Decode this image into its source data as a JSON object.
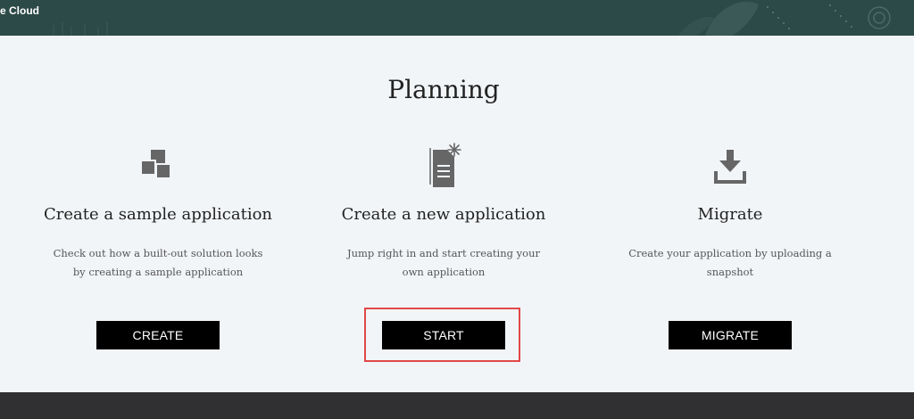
{
  "header": {
    "title": "e Cloud"
  },
  "main": {
    "title": "Planning",
    "cards": [
      {
        "icon": "sample-blocks-icon",
        "title": "Create a sample application",
        "description": "Check out how a built-out solution looks by creating a sample application",
        "button_label": "CREATE"
      },
      {
        "icon": "new-document-icon",
        "title": "Create a new application",
        "description": "Jump right in and start creating your own application",
        "button_label": "START"
      },
      {
        "icon": "download-icon",
        "title": "Migrate",
        "description": "Create your application by uploading a snapshot",
        "button_label": "MIGRATE"
      }
    ]
  },
  "colors": {
    "header_bg": "#2c4a48",
    "page_bg": "#f2f5f8",
    "button_bg": "#000000",
    "highlight": "#e14848",
    "footer_bg": "#303032"
  }
}
